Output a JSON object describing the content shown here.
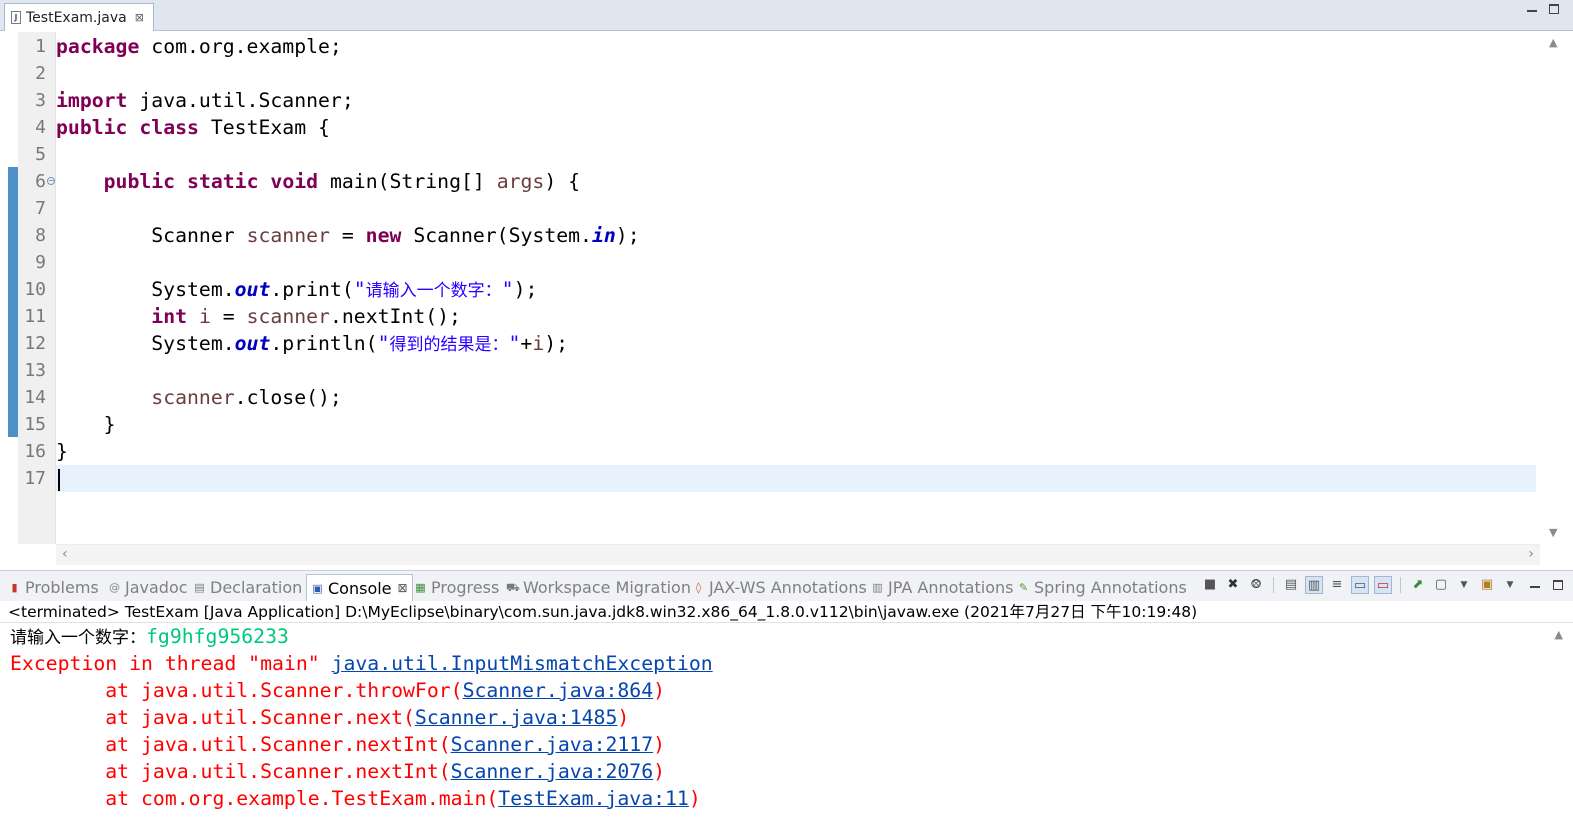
{
  "editor": {
    "tab_title": "TestExam.java",
    "tab_close": "⊠",
    "line_numbers": [
      "1",
      "2",
      "3",
      "4",
      "5",
      "6",
      "7",
      "8",
      "9",
      "10",
      "11",
      "12",
      "13",
      "14",
      "15",
      "16",
      "17"
    ],
    "lines": [
      [
        {
          "t": "package",
          "c": "kw"
        },
        {
          "t": " com.org.example;"
        }
      ],
      [],
      [
        {
          "t": "import",
          "c": "kw"
        },
        {
          "t": " java.util.Scanner;"
        }
      ],
      [
        {
          "t": "public",
          "c": "kw"
        },
        {
          "t": " "
        },
        {
          "t": "class",
          "c": "kw"
        },
        {
          "t": " TestExam {"
        }
      ],
      [],
      [
        {
          "t": "    "
        },
        {
          "t": "public",
          "c": "kw"
        },
        {
          "t": " "
        },
        {
          "t": "static",
          "c": "kw"
        },
        {
          "t": " "
        },
        {
          "t": "void",
          "c": "kw"
        },
        {
          "t": " main(String[] "
        },
        {
          "t": "args",
          "c": "lvar"
        },
        {
          "t": ") {"
        }
      ],
      [],
      [
        {
          "t": "        Scanner "
        },
        {
          "t": "scanner",
          "c": "lvar"
        },
        {
          "t": " = "
        },
        {
          "t": "new",
          "c": "kw"
        },
        {
          "t": " Scanner(System."
        },
        {
          "t": "in",
          "c": "field"
        },
        {
          "t": ");"
        }
      ],
      [],
      [
        {
          "t": "        System."
        },
        {
          "t": "out",
          "c": "field"
        },
        {
          "t": ".print("
        },
        {
          "t": "\"",
          "c": "str"
        },
        {
          "t": "请输入一个数字：",
          "c": "str cjk"
        },
        {
          "t": "\"",
          "c": "str"
        },
        {
          "t": ");"
        }
      ],
      [
        {
          "t": "        "
        },
        {
          "t": "int",
          "c": "kw"
        },
        {
          "t": " "
        },
        {
          "t": "i",
          "c": "lvar"
        },
        {
          "t": " = "
        },
        {
          "t": "scanner",
          "c": "lvar"
        },
        {
          "t": ".nextInt();"
        }
      ],
      [
        {
          "t": "        System."
        },
        {
          "t": "out",
          "c": "field"
        },
        {
          "t": ".println("
        },
        {
          "t": "\"",
          "c": "str"
        },
        {
          "t": "得到的结果是：",
          "c": "str cjk"
        },
        {
          "t": "\"",
          "c": "str"
        },
        {
          "t": "+"
        },
        {
          "t": "i",
          "c": "lvar"
        },
        {
          "t": ");"
        }
      ],
      [],
      [
        {
          "t": "        "
        },
        {
          "t": "scanner",
          "c": "lvar"
        },
        {
          "t": ".close();"
        }
      ],
      [
        {
          "t": "    }"
        }
      ],
      [
        {
          "t": "}"
        }
      ],
      []
    ]
  },
  "views": {
    "tabs": [
      {
        "label": "Problems",
        "icon": "problems-icon",
        "glyph": "▮",
        "color": "#c0392b"
      },
      {
        "label": "Javadoc",
        "icon": "javadoc-icon",
        "glyph": "@",
        "color": "#888"
      },
      {
        "label": "Declaration",
        "icon": "declaration-icon",
        "glyph": "▤",
        "color": "#7a7a7a"
      },
      {
        "label": "Console",
        "icon": "console-icon",
        "glyph": "▣",
        "color": "#2a5db0",
        "active": true
      },
      {
        "label": "Progress",
        "icon": "progress-icon",
        "glyph": "▦",
        "color": "#3a8a3a"
      },
      {
        "label": "Workspace Migration",
        "icon": "workspace-migration-icon",
        "glyph": "⛟",
        "color": "#7a7a7a"
      },
      {
        "label": "JAX-WS Annotations",
        "icon": "jaxws-icon",
        "glyph": "◊",
        "color": "#c06030"
      },
      {
        "label": "JPA Annotations",
        "icon": "jpa-icon",
        "glyph": "▥",
        "color": "#7a7a7a"
      },
      {
        "label": "Spring Annotations",
        "icon": "spring-icon",
        "glyph": "✎",
        "color": "#4a9a30"
      }
    ],
    "console_close": "⊠"
  },
  "console": {
    "header": "<terminated> TestExam [Java Application] D:\\MyEclipse\\binary\\com.sun.java.jdk8.win32.x86_64_1.8.0.v112\\bin\\javaw.exe (2021年7月27日 下午10:19:48)",
    "prompt": "请输入一个数字：",
    "user_input": "fg9hfg956233",
    "exception_prefix": "Exception in thread \"main\" ",
    "exception_class": "java.util.InputMismatchException",
    "stack": [
      {
        "at": "        at java.util.Scanner.throwFor(",
        "link": "Scanner.java:864",
        "end": ")"
      },
      {
        "at": "        at java.util.Scanner.next(",
        "link": "Scanner.java:1485",
        "end": ")"
      },
      {
        "at": "        at java.util.Scanner.nextInt(",
        "link": "Scanner.java:2117",
        "end": ")"
      },
      {
        "at": "        at java.util.Scanner.nextInt(",
        "link": "Scanner.java:2076",
        "end": ")"
      },
      {
        "at": "        at com.org.example.TestExam.main(",
        "link": "TestExam.java:11",
        "end": ")"
      }
    ]
  }
}
